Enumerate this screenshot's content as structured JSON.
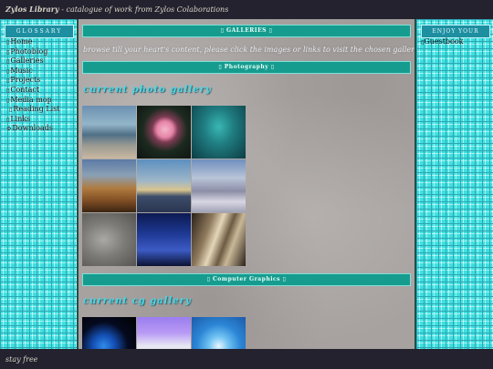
{
  "header": {
    "title_bold": "Zylos Library",
    "title_rest": " - catalogue of work from Zylos Colaborations"
  },
  "sidebar": {
    "heading": "GLOSSARY",
    "items": [
      {
        "label": "Home",
        "icon": "bullet-icon",
        "sub": false
      },
      {
        "label": "Photoblog",
        "icon": "bullet-icon",
        "sub": false
      },
      {
        "label": "Galleries",
        "icon": "bullet-icon",
        "sub": false
      },
      {
        "label": "Music",
        "icon": "bullet-icon",
        "sub": false
      },
      {
        "label": "Projects",
        "icon": "bullet-icon",
        "sub": false
      },
      {
        "label": "Contact",
        "icon": "bullet-icon",
        "sub": false
      },
      {
        "label": "Media mop",
        "icon": "bullet-icon",
        "sub": false
      },
      {
        "label": "Reading List",
        "icon": "bullet-icon",
        "sub": true
      },
      {
        "label": "Links",
        "icon": "bullet-icon",
        "sub": false
      },
      {
        "label": "Downloads",
        "icon": "gear-icon",
        "sub": false
      }
    ]
  },
  "right": {
    "heading": "ENJOY YOUR STAY",
    "guestbook": "Guestbook"
  },
  "main": {
    "galleries_heading": "GALLERIES",
    "intro": "browse till your heart's content, please click the images or links to visit the chosen gallery",
    "photography_heading": "Photography",
    "photo_gallery_title": "current photo gallery",
    "computer_graphics_heading": "Computer Graphics",
    "cg_gallery_title": "current cg gallery"
  },
  "footer": {
    "text": "stay free"
  },
  "colors": {
    "tile_cyan": "#3ee0e0",
    "bar_teal": "#169c8f",
    "gallery_title": "#49d6e3",
    "background": "#23222e"
  }
}
